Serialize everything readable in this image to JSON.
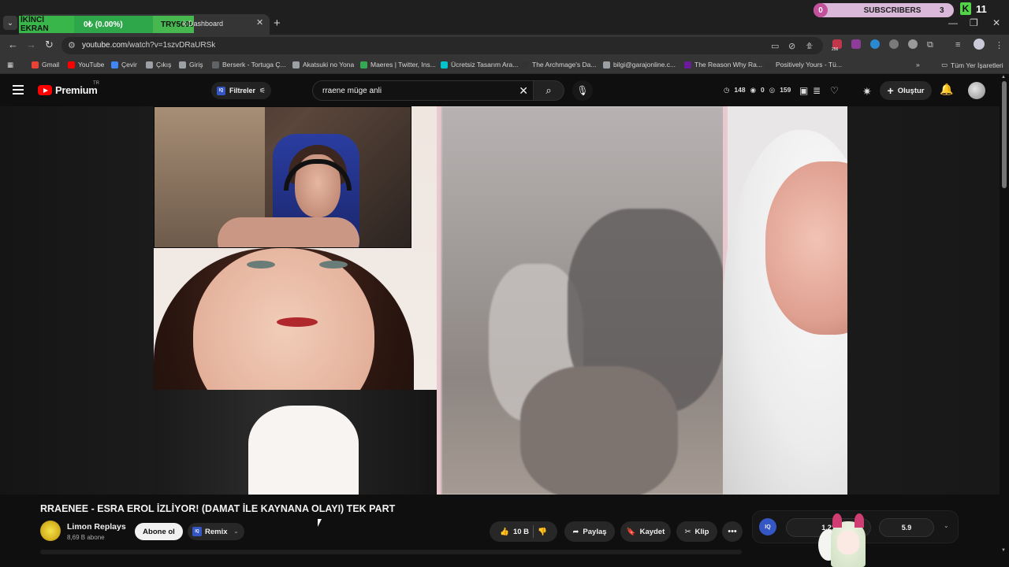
{
  "browser": {
    "tab_title": "k Dashboard",
    "overlay": {
      "seg1": "İKİNCİ EKRAN",
      "seg2": "0₺ (0.00%)",
      "seg3": "TRY5000"
    },
    "subs_widget": {
      "count_left": "0",
      "label": "SUBSCRIBERS",
      "count_right": "3"
    },
    "k_widget": {
      "letter": "K",
      "value": "11"
    },
    "url_host": "youtube.com",
    "url_path": "/watch?v=1szvDRaURSk",
    "bookmarks": [
      {
        "label": "Gmail",
        "color": "#ea4335"
      },
      {
        "label": "YouTube",
        "color": "#ff0000"
      },
      {
        "label": "Çevir",
        "color": "#4285f4"
      },
      {
        "label": "Çıkış",
        "color": "#9aa0a6"
      },
      {
        "label": "Giriş",
        "color": "#9aa0a6"
      },
      {
        "label": "Berserk - Tortuga Ç...",
        "color": "#5f6368"
      },
      {
        "label": "Akatsuki no Yona",
        "color": "#9aa0a6"
      },
      {
        "label": "Maeres | Twitter, Ins...",
        "color": "#34a853"
      },
      {
        "label": "Ücretsiz Tasarım Ara...",
        "color": "#00c4cc"
      },
      {
        "label": "The Archmage's Da...",
        "color": "#333333"
      },
      {
        "label": "bilgi@garajonline.c...",
        "color": "#9aa0a6"
      },
      {
        "label": "The Reason Why Ra...",
        "color": "#6a1b9a"
      },
      {
        "label": "Positively Yours - Tü...",
        "color": "#333333"
      }
    ],
    "all_bookmarks": "Tüm Yer İşaretleri",
    "ext_badge": "256"
  },
  "youtube": {
    "brand": "Premium",
    "region": "TR",
    "filters_label": "Filtreler",
    "search_query": "rraene müge anli",
    "stats": {
      "a": "148",
      "b": "0",
      "c": "159"
    },
    "create_label": "Oluştur"
  },
  "video": {
    "title": "RRAENEE - ESRA EROL İZLİYOR! (DAMAT İLE KAYNANA OLAYI) TEK PART",
    "channel_name": "Limon Replays",
    "channel_subs": "8,69 B abone",
    "subscribe_label": "Abone ol",
    "remix_label": "Remix",
    "likes": "10 B",
    "share_label": "Paylaş",
    "save_label": "Kaydet",
    "clip_label": "Klip"
  },
  "iq_panel": {
    "badge": "IQ",
    "value_left": "1.21",
    "value_right": "5.9"
  },
  "colors": {
    "bg": "#0f0f0f",
    "accent_red": "#ff0000",
    "iq_blue": "#3557c5",
    "overlay_green": "#38b64a"
  }
}
